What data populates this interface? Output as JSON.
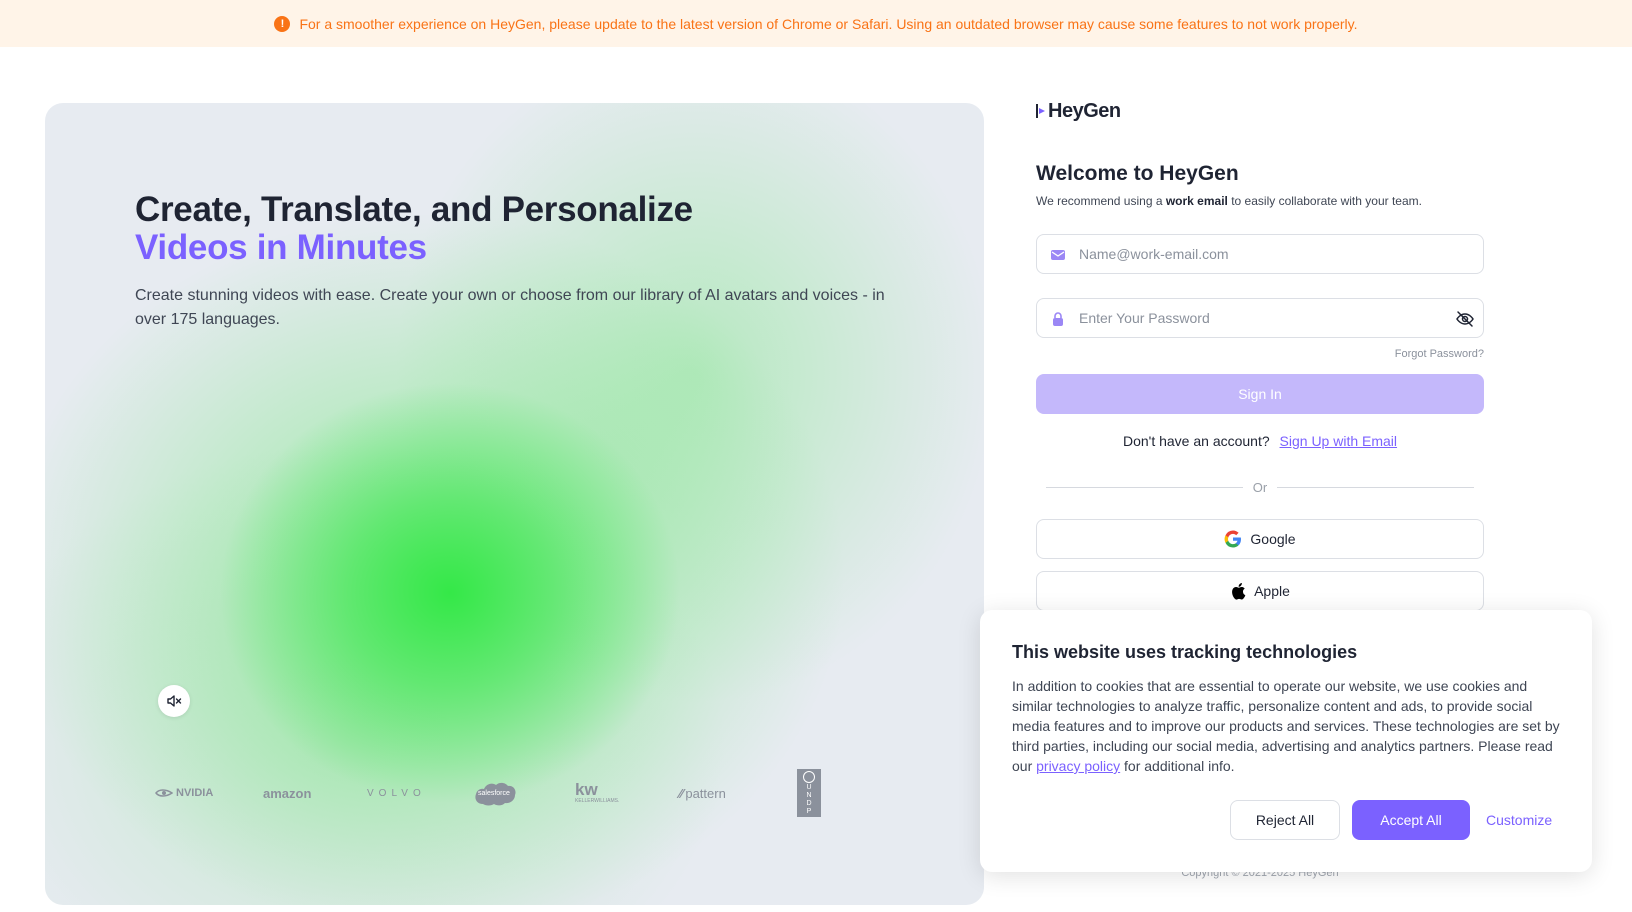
{
  "banner": {
    "icon": "info-icon",
    "text": "For a smoother experience on HeyGen, please update to the latest version of Chrome or Safari. Using an outdated browser may cause some features to not work properly.",
    "color": "#f97316"
  },
  "hero": {
    "title_line1": "Create, Translate, and Personalize",
    "title_line2": "Videos in Minutes",
    "description": "Create stunning videos with ease. Create your own or choose from our library of AI avatars and voices - in over 175 languages.",
    "mute_icon": "speaker-muted-icon",
    "logos": [
      "nvidia",
      "amazon",
      "volvo",
      "salesforce",
      "kw",
      "pattern",
      "undp"
    ],
    "logo_labels": {
      "nvidia": "NVIDIA",
      "amazon": "amazon",
      "volvo": "VOLVO",
      "salesforce": "salesforce",
      "kw": "kw",
      "kw_sub": "KELLERWILLIAMS.",
      "pattern": "pattern",
      "undp": [
        "U",
        "N",
        "D",
        "P"
      ]
    }
  },
  "login": {
    "brand": "HeyGen",
    "welcome_title": "Welcome to HeyGen",
    "welcome_sub_pre": "We recommend using a ",
    "welcome_sub_bold": "work email",
    "welcome_sub_post": " to easily collaborate with your team.",
    "email_placeholder": "Name@work-email.com",
    "password_placeholder": "Enter Your Password",
    "forgot": "Forgot Password?",
    "signin": "Sign In",
    "no_account": "Don't have an account?",
    "signup_link": "Sign Up with Email",
    "or": "Or",
    "google": "Google",
    "apple": "Apple",
    "accent": "#7b61ff"
  },
  "footer": {
    "copyright": "Copyright © 2021-2025 HeyGen"
  },
  "cookie": {
    "title": "This website uses tracking technologies",
    "body": "In addition to cookies that are essential to operate our website, we use cookies and similar technologies to analyze traffic, personalize content and ads, to provide social media features and to improve our products and services. These technologies are set by third parties, including our social media, advertising and analytics partners. Please read our ",
    "link": "privacy policy",
    "body_end": " for additional info.",
    "reject": "Reject All",
    "accept": "Accept All",
    "customize": "Customize"
  }
}
